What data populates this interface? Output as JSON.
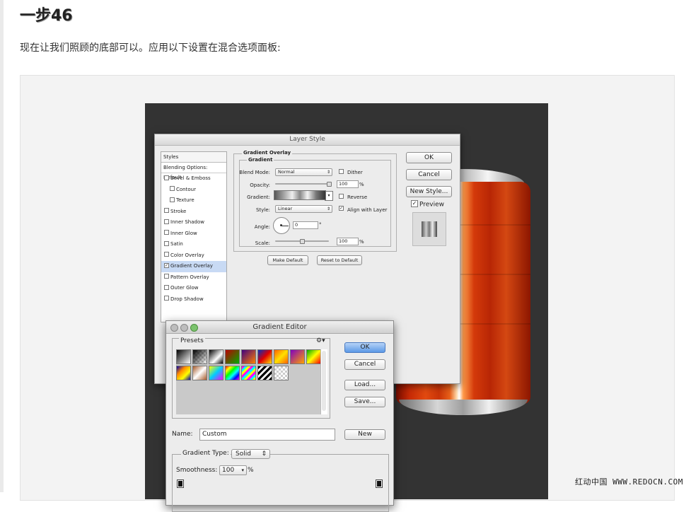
{
  "article": {
    "step_title": "一步46",
    "intro": "现在让我们照顾的底部可以。应用以下设置在混合选项面板:"
  },
  "layer_style": {
    "title": "Layer Style",
    "styles_header": "Styles",
    "blending_options": "Blending Options: Default",
    "items": [
      {
        "label": "Bevel & Emboss",
        "checked": false,
        "indent": false,
        "selected": false
      },
      {
        "label": "Contour",
        "checked": false,
        "indent": true,
        "selected": false
      },
      {
        "label": "Texture",
        "checked": false,
        "indent": true,
        "selected": false
      },
      {
        "label": "Stroke",
        "checked": false,
        "indent": false,
        "selected": false
      },
      {
        "label": "Inner Shadow",
        "checked": false,
        "indent": false,
        "selected": false
      },
      {
        "label": "Inner Glow",
        "checked": false,
        "indent": false,
        "selected": false
      },
      {
        "label": "Satin",
        "checked": false,
        "indent": false,
        "selected": false
      },
      {
        "label": "Color Overlay",
        "checked": false,
        "indent": false,
        "selected": false
      },
      {
        "label": "Gradient Overlay",
        "checked": true,
        "indent": false,
        "selected": true
      },
      {
        "label": "Pattern Overlay",
        "checked": false,
        "indent": false,
        "selected": false
      },
      {
        "label": "Outer Glow",
        "checked": false,
        "indent": false,
        "selected": false
      },
      {
        "label": "Drop Shadow",
        "checked": false,
        "indent": false,
        "selected": false
      }
    ],
    "section_title": "Gradient Overlay",
    "subsection_title": "Gradient",
    "blend_mode_label": "Blend Mode:",
    "blend_mode_value": "Normal",
    "dither_label": "Dither",
    "opacity_label": "Opacity:",
    "opacity_value": "100",
    "opacity_unit": "%",
    "gradient_label": "Gradient:",
    "reverse_label": "Reverse",
    "style_label": "Style:",
    "style_value": "Linear",
    "align_label": "Align with Layer",
    "angle_label": "Angle:",
    "angle_value": "0",
    "angle_unit": "°",
    "scale_label": "Scale:",
    "scale_value": "100",
    "scale_unit": "%",
    "make_default": "Make Default",
    "reset_default": "Reset to Default",
    "ok": "OK",
    "cancel": "Cancel",
    "new_style": "New Style...",
    "preview_label": "Preview",
    "opacity_fraction": 1.0,
    "scale_fraction": 0.5
  },
  "gradient_editor": {
    "title": "Gradient Editor",
    "presets_label": "Presets",
    "ok": "OK",
    "cancel": "Cancel",
    "load": "Load...",
    "save": "Save...",
    "name_label": "Name:",
    "name_value": "Custom",
    "new": "New",
    "gradient_type_label": "Gradient Type:",
    "gradient_type_value": "Solid",
    "smoothness_label": "Smoothness:",
    "smoothness_value": "100",
    "smoothness_unit": "%"
  },
  "watermark": "红动中国 WWW.REDOCN.COM",
  "colors": {
    "selection": "#c8daf4",
    "primary_button": "#5b99e6",
    "canvas": "#333333"
  }
}
